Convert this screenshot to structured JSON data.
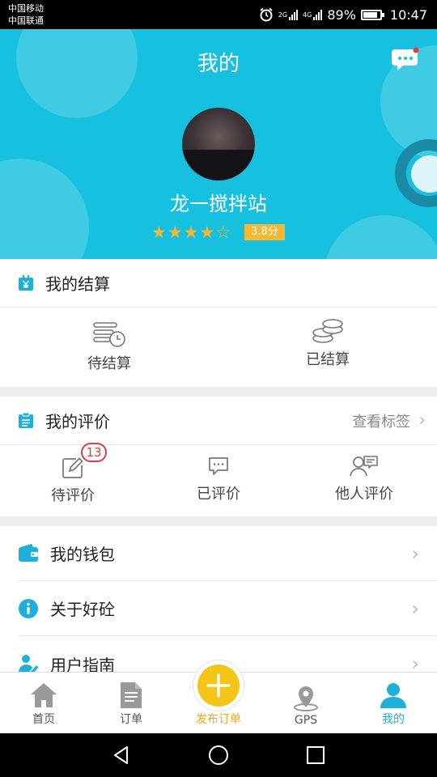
{
  "status_bar": {
    "carrier_1": "中国移动",
    "carrier_2": "中国联通",
    "network_1": "2G",
    "network_2": "4G",
    "battery": "89%",
    "time": "10:47"
  },
  "header": {
    "title": "我的",
    "station_name": "龙一搅拌站",
    "rating": 3.8,
    "score_label": "3.8分",
    "colors": {
      "background": "#17c0de",
      "star": "#f7b733",
      "score_badge": "#f5b830"
    }
  },
  "settlement": {
    "title": "我的结算",
    "items": [
      {
        "label": "待结算",
        "icon": "pending-settlement-icon"
      },
      {
        "label": "已结算",
        "icon": "coins-stack-icon"
      }
    ]
  },
  "reviews": {
    "title": "我的评价",
    "link": "查看标签",
    "items": [
      {
        "label": "待评价",
        "icon": "edit-icon",
        "badge": "13"
      },
      {
        "label": "已评价",
        "icon": "comment-icon"
      },
      {
        "label": "他人评价",
        "icon": "user-comment-icon"
      }
    ]
  },
  "menu": [
    {
      "label": "我的钱包",
      "icon": "wallet-icon"
    },
    {
      "label": "关于好砼",
      "icon": "info-icon"
    },
    {
      "label": "用户指南",
      "icon": "user-guide-icon"
    }
  ],
  "tabs": [
    {
      "label": "首页",
      "icon": "home-icon"
    },
    {
      "label": "订单",
      "icon": "order-icon"
    },
    {
      "label": "发布订单",
      "icon": "plus-icon"
    },
    {
      "label": "GPS",
      "icon": "gps-icon"
    },
    {
      "label": "我的",
      "icon": "profile-icon",
      "active": true
    }
  ],
  "colors": {
    "accent": "#1eb0d8",
    "badge": "#e63b3b",
    "publish": "#f5c419"
  }
}
